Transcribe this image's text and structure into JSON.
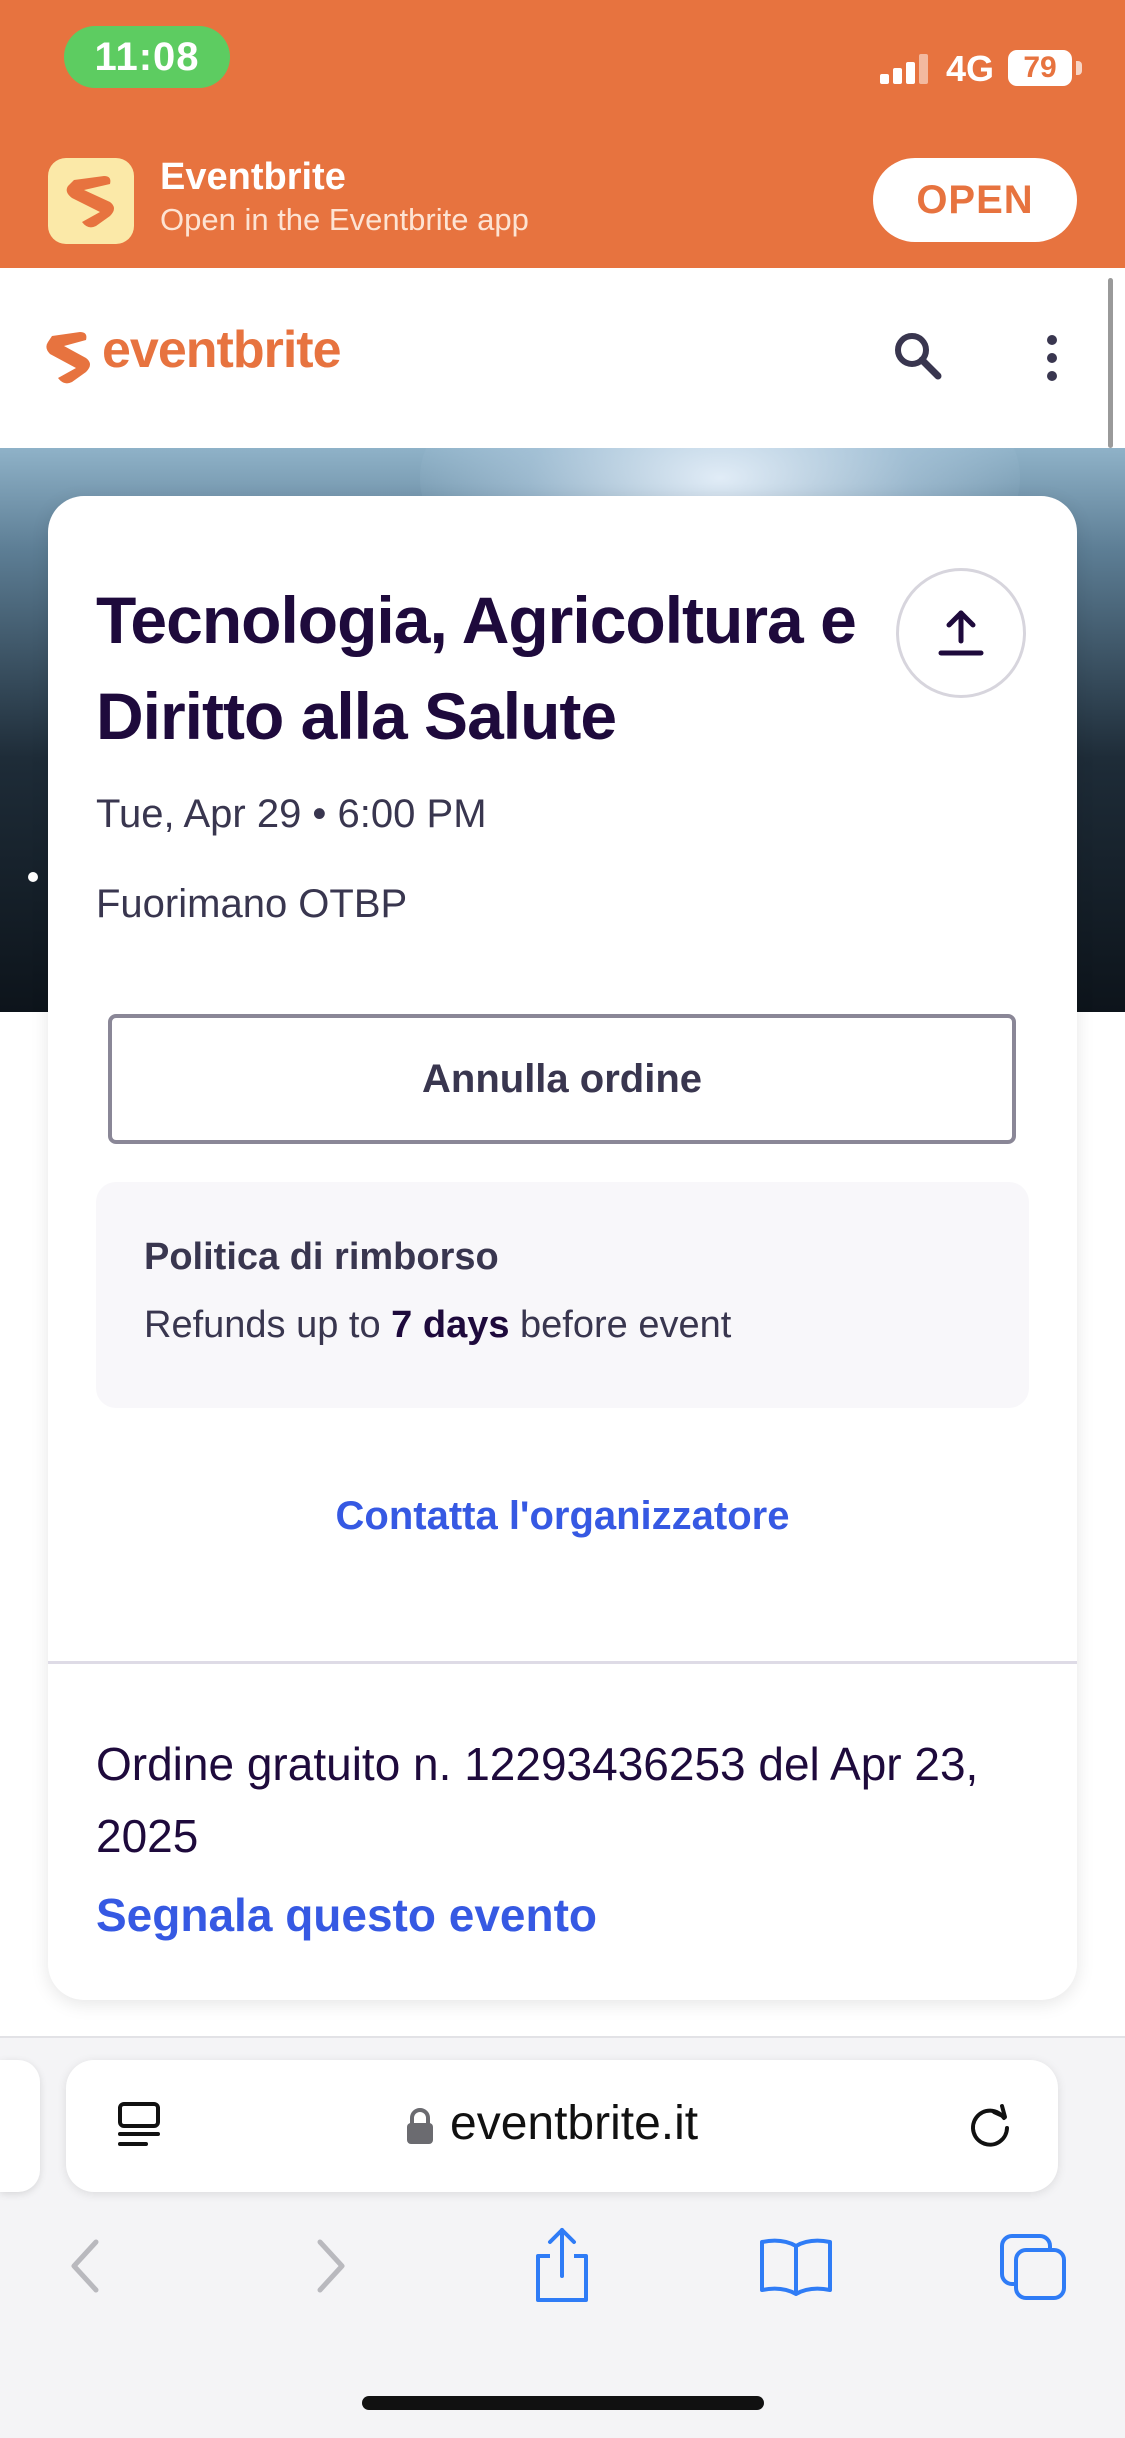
{
  "status_bar": {
    "time": "11:08",
    "network": "4G",
    "battery": "79"
  },
  "app_banner": {
    "name": "Eventbrite",
    "subtitle": "Open in the Eventbrite app",
    "open_label": "OPEN"
  },
  "site_header": {
    "logo_text": "eventbrite"
  },
  "event": {
    "title": "Tecnologia, Agricoltura e Diritto alla Salute",
    "date": "Tue, Apr 29 • 6:00 PM",
    "venue": "Fuorimano OTBP"
  },
  "actions": {
    "cancel_label": "Annulla ordine"
  },
  "refund": {
    "title": "Politica di rimborso",
    "prefix": "Refunds up to ",
    "days": "7 days",
    "suffix": " before event"
  },
  "contact_label": "Contatta l'organizzatore",
  "order": {
    "text": "Ordine gratuito n. 12293436253 del Apr 23, 2025",
    "report_label": "Segnala questo evento"
  },
  "browser": {
    "url": "eventbrite.it"
  },
  "colors": {
    "brand_orange": "#e7733f",
    "link_blue": "#3659e3",
    "title_dark": "#1e0a3c"
  }
}
